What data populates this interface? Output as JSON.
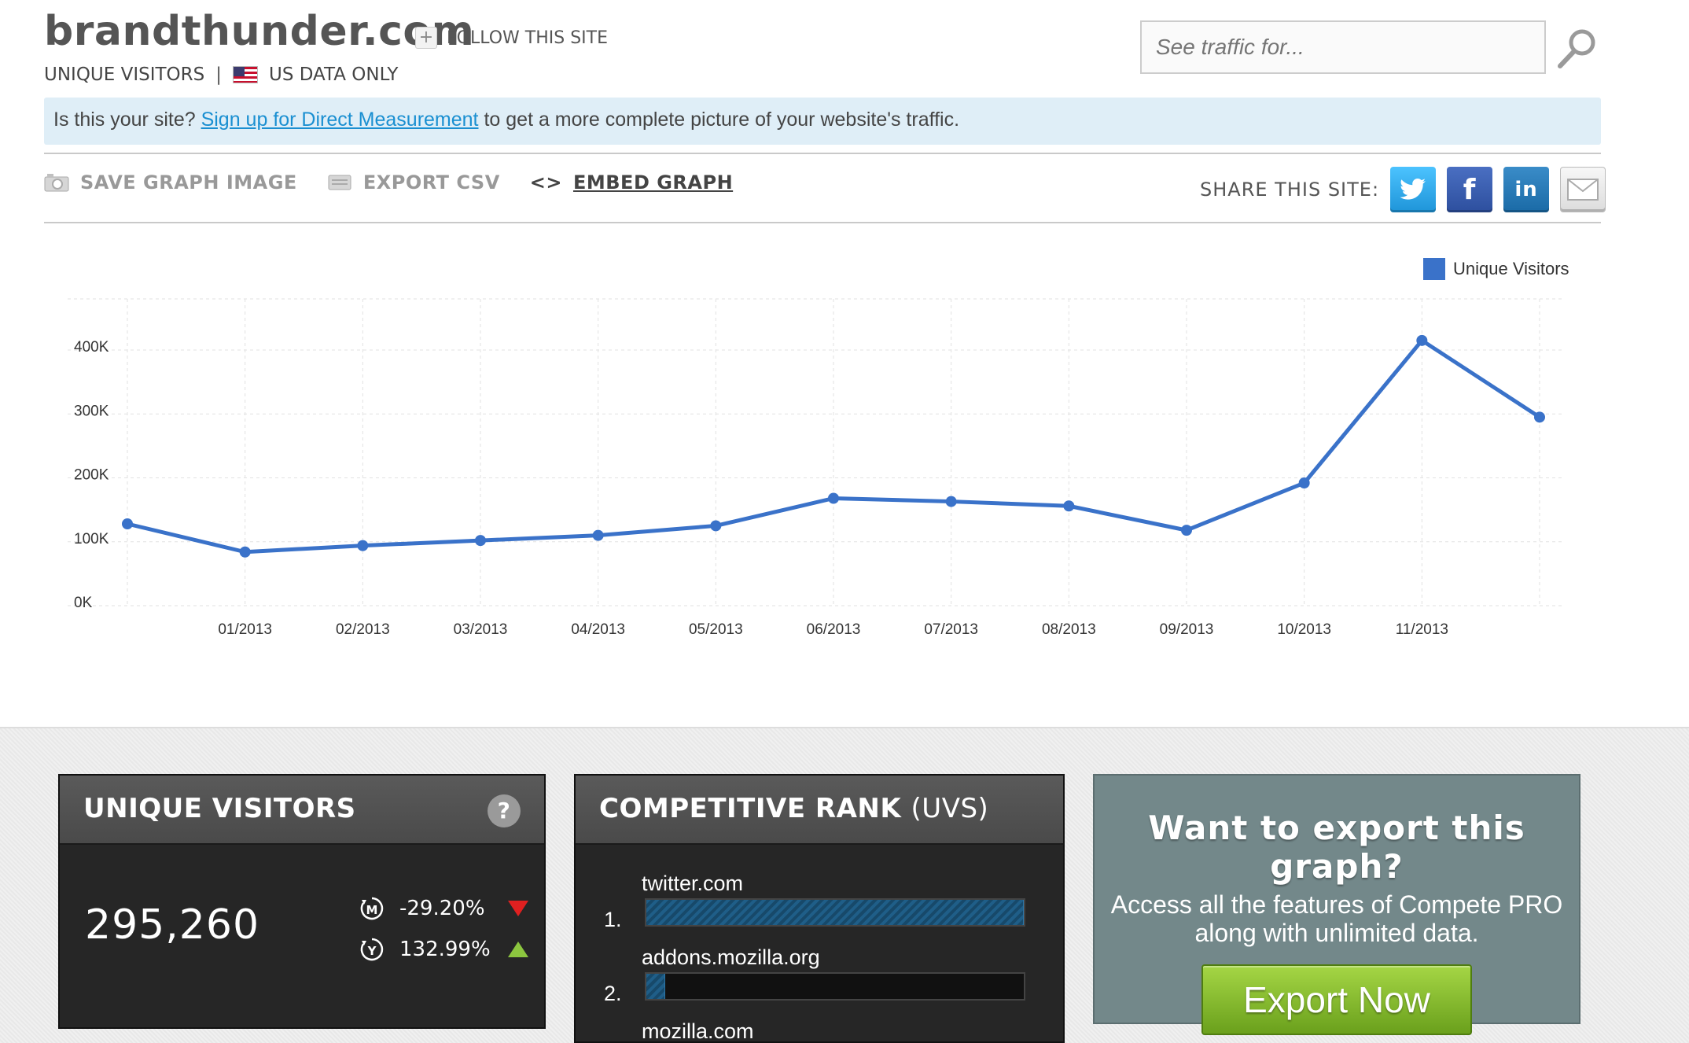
{
  "header": {
    "site_title": "brandthunder.com",
    "follow_label": "FOLLOW THIS SITE",
    "metric_label": "UNIQUE VISITORS",
    "separator": "|",
    "region_label": "US DATA ONLY",
    "search_placeholder": "See traffic for..."
  },
  "banner": {
    "prefix": "Is this your site? ",
    "link": "Sign up for Direct Measurement",
    "suffix": " to get a more complete picture of your website's traffic."
  },
  "toolbar": {
    "save_graph": "SAVE GRAPH IMAGE",
    "export_csv": "EXPORT CSV",
    "embed_symbol": "<>",
    "embed_graph": "EMBED GRAPH",
    "share_label": "SHARE THIS SITE:"
  },
  "chart_data": {
    "type": "line",
    "ylim": [
      0,
      480000
    ],
    "y_ticks": [
      0,
      100000,
      200000,
      300000,
      400000
    ],
    "y_tick_labels": [
      "0K",
      "100K",
      "200K",
      "300K",
      "400K"
    ],
    "x_tick_labels": [
      "01/2013",
      "02/2013",
      "03/2013",
      "04/2013",
      "05/2013",
      "06/2013",
      "07/2013",
      "08/2013",
      "09/2013",
      "10/2013",
      "11/2013"
    ],
    "grid": true,
    "legend_position": "top-right",
    "series": [
      {
        "name": "Unique Visitors",
        "color": "#3a72c9",
        "values": [
          128000,
          84000,
          94000,
          102000,
          110000,
          125000,
          168000,
          163000,
          156000,
          118000,
          192000,
          415000,
          295000
        ]
      }
    ]
  },
  "stats": {
    "title": "UNIQUE VISITORS",
    "help": "?",
    "value": "295,260",
    "monthly_change": "-29.20%",
    "yearly_change": "132.99%",
    "monthly_badge": "M",
    "yearly_badge": "Y"
  },
  "rank": {
    "title": "COMPETITIVE RANK",
    "title_suffix": "(UVS)",
    "items": [
      {
        "num": "1.",
        "site": "twitter.com",
        "fill": 1.0
      },
      {
        "num": "2.",
        "site": "addons.mozilla.org",
        "fill": 0.05
      },
      {
        "site": "mozilla.com"
      }
    ]
  },
  "promo": {
    "title": "Want to export this graph?",
    "line1": "Access all the features of Compete PRO",
    "line2": "along with unlimited data.",
    "button": "Export Now"
  },
  "colors": {
    "accent": "#3a72c9",
    "link": "#1a8fd1",
    "down": "#e02020",
    "up": "#8cc63f"
  }
}
